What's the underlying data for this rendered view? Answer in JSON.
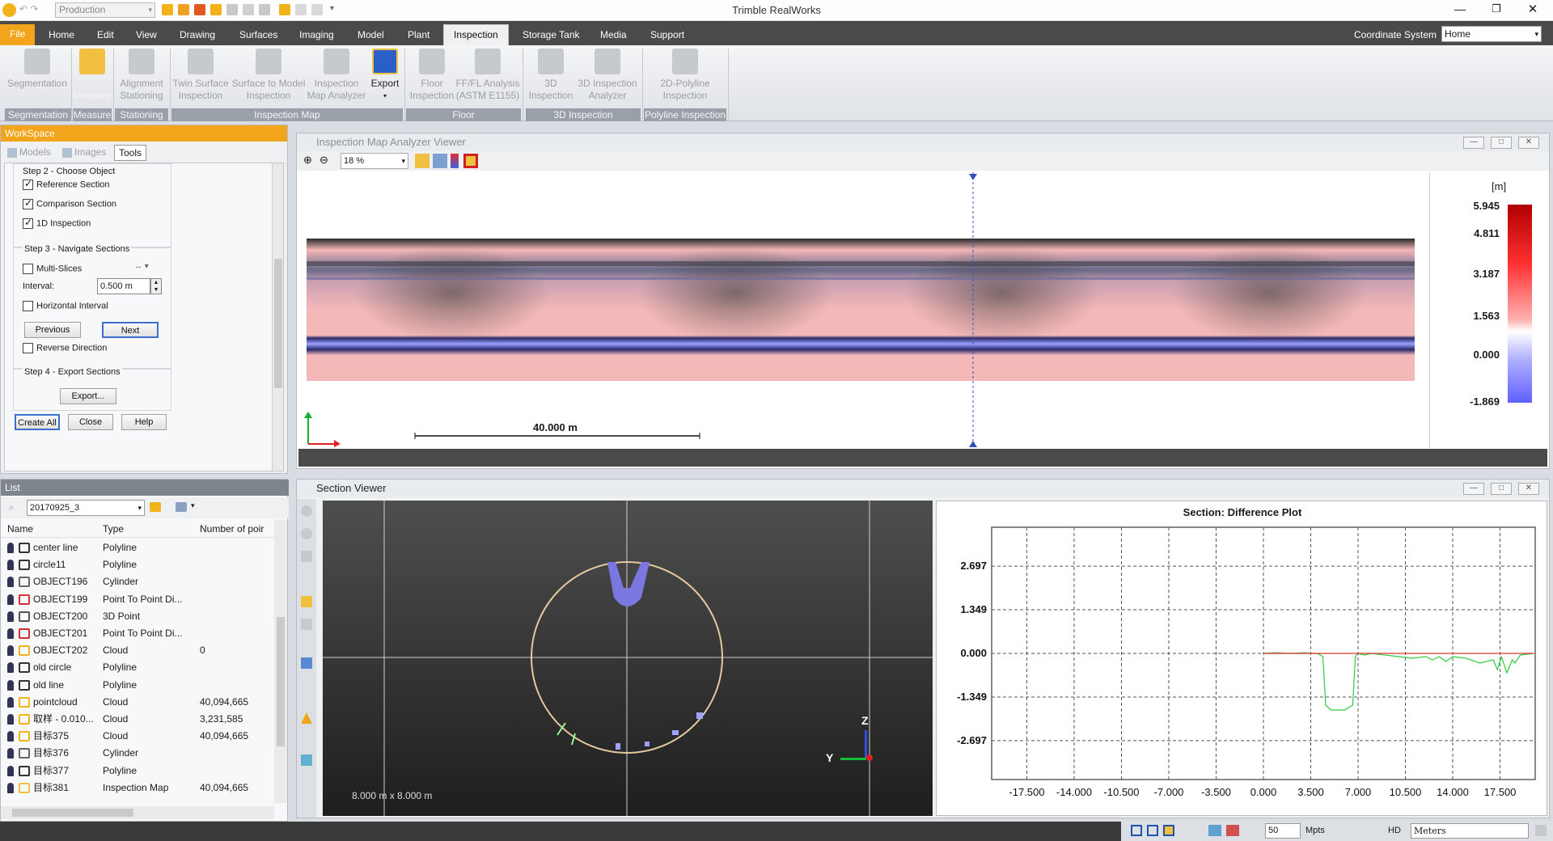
{
  "app": {
    "title": "Trimble RealWorks",
    "project_dropdown": "Production",
    "coordinate_system_label": "Coordinate System",
    "coordinate_system_value": "Home"
  },
  "tabs": [
    "File",
    "Home",
    "Edit",
    "View",
    "Drawing",
    "Surfaces",
    "Imaging",
    "Model",
    "Plant",
    "Inspection",
    "Storage Tank",
    "Media",
    "Support"
  ],
  "ribbon": {
    "buttons": [
      {
        "l1": "Segmentation",
        "l2": ""
      },
      {
        "l1": "",
        "l2": "Measure"
      },
      {
        "l1": "Alignment",
        "l2": "Stationing"
      },
      {
        "l1": "Twin Surface",
        "l2": "Inspection"
      },
      {
        "l1": "Surface to Model",
        "l2": "Inspection"
      },
      {
        "l1": "Inspection",
        "l2": "Map Analyzer"
      },
      {
        "l1": "Export",
        "l2": ""
      },
      {
        "l1": "Floor",
        "l2": "Inspection"
      },
      {
        "l1": "FF/FL Analysis",
        "l2": "(ASTM E1155)"
      },
      {
        "l1": "3D",
        "l2": "Inspection"
      },
      {
        "l1": "3D Inspection",
        "l2": "Analyzer"
      },
      {
        "l1": "2D-Polyline",
        "l2": "Inspection"
      }
    ],
    "groups": [
      "Segmentation",
      "Measure",
      "Stationing",
      "Inspection Map",
      "Floor",
      "3D Inspection",
      "Polyline Inspection"
    ]
  },
  "workspace": {
    "title": "WorkSpace",
    "tabs": [
      "Models",
      "Images",
      "Tools"
    ],
    "step2": "Step 2 - Choose Object",
    "reference_section": "Reference Section",
    "comparison_section": "Comparison Section",
    "inspection_1d": "1D Inspection",
    "step3": "Step 3 - Navigate Sections",
    "multi_slices": "Multi-Slices",
    "interval_label": "Interval:",
    "interval_value": "0.500 m",
    "horizontal_interval": "Horizontal Interval",
    "previous": "Previous",
    "next": "Next",
    "reverse_direction": "Reverse Direction",
    "step4": "Step 4 - Export Sections",
    "export": "Export...",
    "create_all": "Create All",
    "close": "Close",
    "help": "Help"
  },
  "list": {
    "title": "List",
    "dropdown": "20170925_3",
    "headers": [
      "Name",
      "Type",
      "Number of poir"
    ],
    "rows": [
      {
        "name": "center line",
        "type": "Polyline",
        "count": ""
      },
      {
        "name": "circle11",
        "type": "Polyline",
        "count": ""
      },
      {
        "name": "OBJECT196",
        "type": "Cylinder",
        "count": ""
      },
      {
        "name": "OBJECT199",
        "type": "Point To Point Di...",
        "count": ""
      },
      {
        "name": "OBJECT200",
        "type": "3D Point",
        "count": ""
      },
      {
        "name": "OBJECT201",
        "type": "Point To Point Di...",
        "count": ""
      },
      {
        "name": "OBJECT202",
        "type": "Cloud",
        "count": "0"
      },
      {
        "name": "old circle",
        "type": "Polyline",
        "count": ""
      },
      {
        "name": "old line",
        "type": "Polyline",
        "count": ""
      },
      {
        "name": "pointcloud",
        "type": "Cloud",
        "count": "40,094,665"
      },
      {
        "name": "取样 - 0.010...",
        "type": "Cloud",
        "count": "3,231,585"
      },
      {
        "name": "目标375",
        "type": "Cloud",
        "count": "40,094,665"
      },
      {
        "name": "目标376",
        "type": "Cylinder",
        "count": ""
      },
      {
        "name": "目标377",
        "type": "Polyline",
        "count": ""
      },
      {
        "name": "目标381",
        "type": "Inspection Map",
        "count": "40,094,665"
      }
    ]
  },
  "analyzer": {
    "title": "Inspection Map Analyzer Viewer",
    "zoom": "18 %",
    "scale_label": "40.000 m",
    "legend_unit": "[m]",
    "legend_values": [
      "5.945",
      "4.811",
      "3.187",
      "1.563",
      "0.000",
      "-1.869"
    ]
  },
  "section_viewer": {
    "title": "Section Viewer",
    "dims": "8.000 m x 8.000 m",
    "axis_z": "Z",
    "axis_y": "Y"
  },
  "chart_data": {
    "type": "line",
    "title": "Section: Difference Plot",
    "xlabel": "",
    "ylabel": "",
    "x_ticks": [
      -17.5,
      -14.0,
      -10.5,
      -7.0,
      -3.5,
      0.0,
      3.5,
      7.0,
      10.5,
      14.0,
      17.5
    ],
    "x_tick_labels": [
      "-17.500",
      "-14.000",
      "-10.500",
      "-7.000",
      "-3.500",
      "0.000",
      "3.500",
      "7.000",
      "10.500",
      "14.000",
      "17.500"
    ],
    "y_ticks": [
      2.697,
      1.349,
      0.0,
      -1.349,
      -2.697
    ],
    "y_tick_labels": [
      "2.697",
      "1.349",
      "0.000",
      "-1.349",
      "-2.697"
    ],
    "xlim": [
      -20.1,
      20.1
    ],
    "ylim": [
      -3.9,
      3.9
    ],
    "grid": true,
    "series": [
      {
        "color": "#2ecc40",
        "x": [
          0.0,
          1.0,
          2.0,
          3.0,
          3.5,
          4.0,
          4.4,
          4.6,
          5.0,
          6.0,
          6.6,
          6.8,
          7.0,
          7.5,
          8.0,
          9.0,
          10.0,
          11.0,
          12.0,
          12.5,
          13.0,
          13.5,
          14.0,
          15.0,
          16.0,
          17.0,
          17.3,
          17.6,
          18.0,
          18.4,
          18.6,
          19.0,
          20.0
        ],
        "y": [
          0.0,
          0.02,
          0.0,
          0.02,
          0.0,
          0.0,
          -0.1,
          -1.6,
          -1.75,
          -1.75,
          -1.6,
          -0.1,
          0.0,
          -0.05,
          0.0,
          -0.05,
          -0.1,
          -0.15,
          -0.1,
          -0.2,
          -0.1,
          -0.25,
          -0.1,
          -0.15,
          -0.3,
          -0.2,
          -0.5,
          -0.1,
          -0.6,
          -0.2,
          -0.3,
          -0.05,
          0.0
        ]
      },
      {
        "color": "#e03030",
        "x": [
          0.0,
          20.0
        ],
        "y": [
          0.0,
          0.0
        ]
      }
    ]
  },
  "status": {
    "points_value": "50",
    "points_unit": "Mpts",
    "hd": "HD",
    "units": "Meters"
  }
}
